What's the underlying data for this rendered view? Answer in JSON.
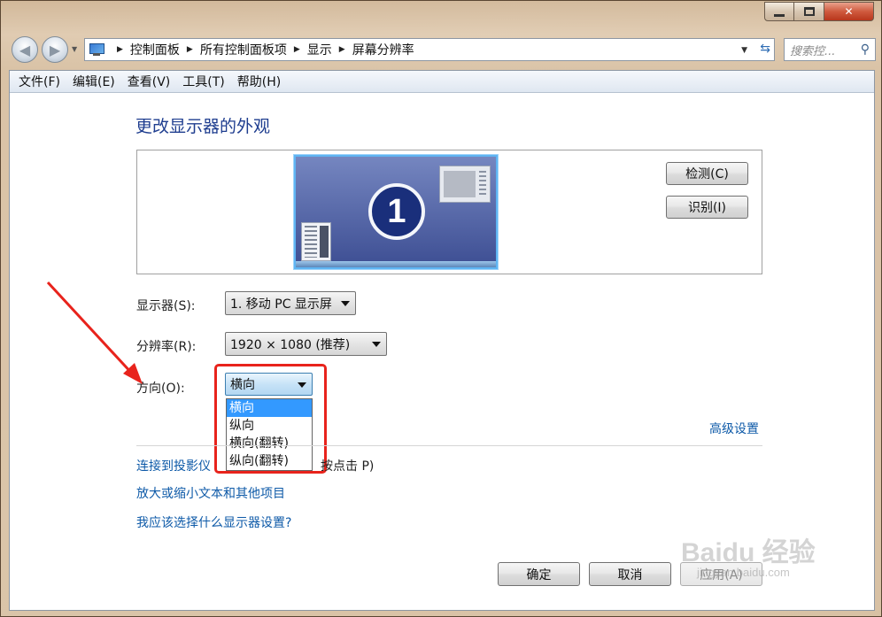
{
  "window": {
    "minimize_label": "",
    "maximize_label": "",
    "close_label": "✕"
  },
  "nav": {
    "breadcrumbs": [
      "控制面板",
      "所有控制面板项",
      "显示",
      "屏幕分辨率"
    ],
    "search_placeholder": "搜索控..."
  },
  "menubar": {
    "items": [
      "文件(F)",
      "编辑(E)",
      "查看(V)",
      "工具(T)",
      "帮助(H)"
    ]
  },
  "main": {
    "heading": "更改显示器的外观",
    "monitor_number": "1",
    "detect_button": "检测(C)",
    "identify_button": "识别(I)",
    "display_label": "显示器(S):",
    "display_value": "1. 移动 PC 显示屏",
    "resolution_label": "分辨率(R):",
    "resolution_value": "1920 × 1080 (推荐)",
    "orientation_label": "方向(O):",
    "orientation_value": "横向",
    "orientation_options": [
      "横向",
      "纵向",
      "横向(翻转)",
      "纵向(翻转)"
    ],
    "advanced_link": "高级设置",
    "projector_link": "连接到投影仪",
    "projector_hint": "按点击 P)",
    "text_size_link": "放大或缩小文本和其他项目",
    "which_settings_link": "我应该选择什么显示器设置?"
  },
  "footer": {
    "ok": "确定",
    "cancel": "取消",
    "apply": "应用(A)"
  },
  "watermark": {
    "text": "Baidu 经验",
    "sub": "jingyan.baidu.com"
  },
  "colors": {
    "annotation": "#e8231c",
    "link": "#0e5aa8",
    "heading": "#1e3d8f",
    "selection": "#3399ff"
  }
}
